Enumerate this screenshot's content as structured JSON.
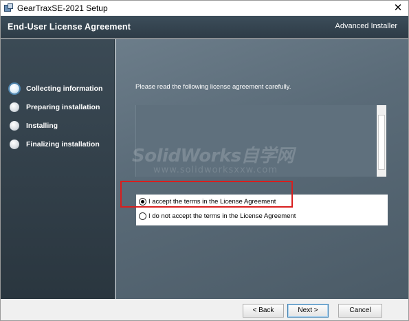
{
  "window": {
    "title": "GearTraxSE-2021 Setup",
    "close_glyph": "✕",
    "icon": "installer-app-icon"
  },
  "header": {
    "title": "End-User License Agreement",
    "brand": "Advanced Installer"
  },
  "sidebar": {
    "steps": [
      {
        "label": "Collecting information",
        "active": true
      },
      {
        "label": "Preparing installation",
        "active": false
      },
      {
        "label": "Installing",
        "active": false
      },
      {
        "label": "Finalizing installation",
        "active": false
      }
    ]
  },
  "main": {
    "instruction": "Please read the following license agreement carefully.",
    "options": [
      {
        "label": "I accept the terms in the License Agreement",
        "checked": true
      },
      {
        "label": "I do not accept the terms in the License Agreement",
        "checked": false
      }
    ],
    "watermark": {
      "text": "SolidWorks自学网",
      "url": "www.solidworksxxw.com"
    }
  },
  "footer": {
    "back_label": "< Back",
    "next_label": "Next >",
    "cancel_label": "Cancel"
  },
  "colors": {
    "highlight": "#d81e1e",
    "header": "#34444f",
    "panel": "#5f707d"
  }
}
